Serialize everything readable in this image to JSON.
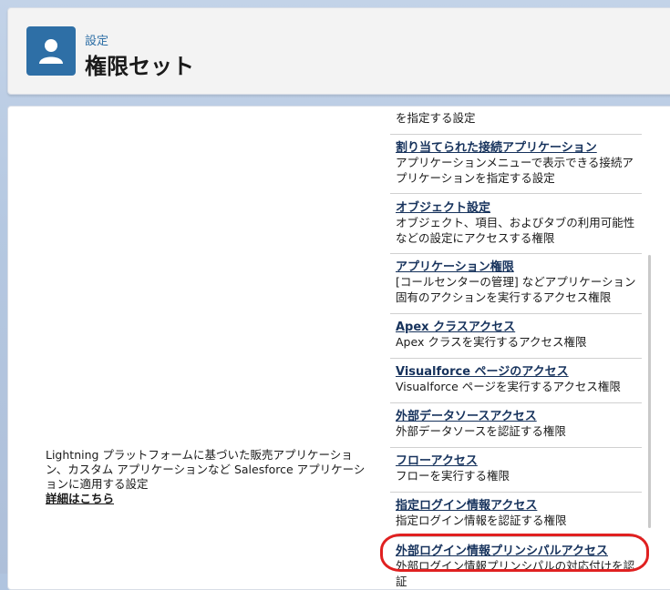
{
  "header": {
    "breadcrumb": "設定",
    "title": "権限セット",
    "icon": "user-icon"
  },
  "left": {
    "description": "Lightning プラットフォームに基づいた販売アプリケーション、カスタム アプリケーションなど Salesforce アプリケーションに適用する設定",
    "more_link": "詳細はこちら"
  },
  "items": [
    {
      "title": "",
      "desc": "を指定する設定"
    },
    {
      "title": "割り当てられた接続アプリケーション",
      "desc": "アプリケーションメニューで表示できる接続アプリケーションを指定する設定"
    },
    {
      "title": "オブジェクト設定",
      "desc": "オブジェクト、項目、およびタブの利用可能性などの設定にアクセスする権限"
    },
    {
      "title": "アプリケーション権限",
      "desc": "[コールセンターの管理] などアプリケーション固有のアクションを実行するアクセス権限"
    },
    {
      "title": "Apex クラスアクセス",
      "desc": "Apex クラスを実行するアクセス権限"
    },
    {
      "title": "Visualforce ページのアクセス",
      "desc": "Visualforce ページを実行するアクセス権限"
    },
    {
      "title": "外部データソースアクセス",
      "desc": "外部データソースを認証する権限"
    },
    {
      "title": "フローアクセス",
      "desc": "フローを実行する権限"
    },
    {
      "title": "指定ログイン情報アクセス",
      "desc": "指定ログイン情報を認証する権限"
    },
    {
      "title": "外部ログイン情報プリンシパルアクセス",
      "desc": "外部ログイン情報プリンシパルの対応付けを認証"
    }
  ],
  "colors": {
    "accent": "#2e6fa6",
    "highlight": "#e02020"
  }
}
